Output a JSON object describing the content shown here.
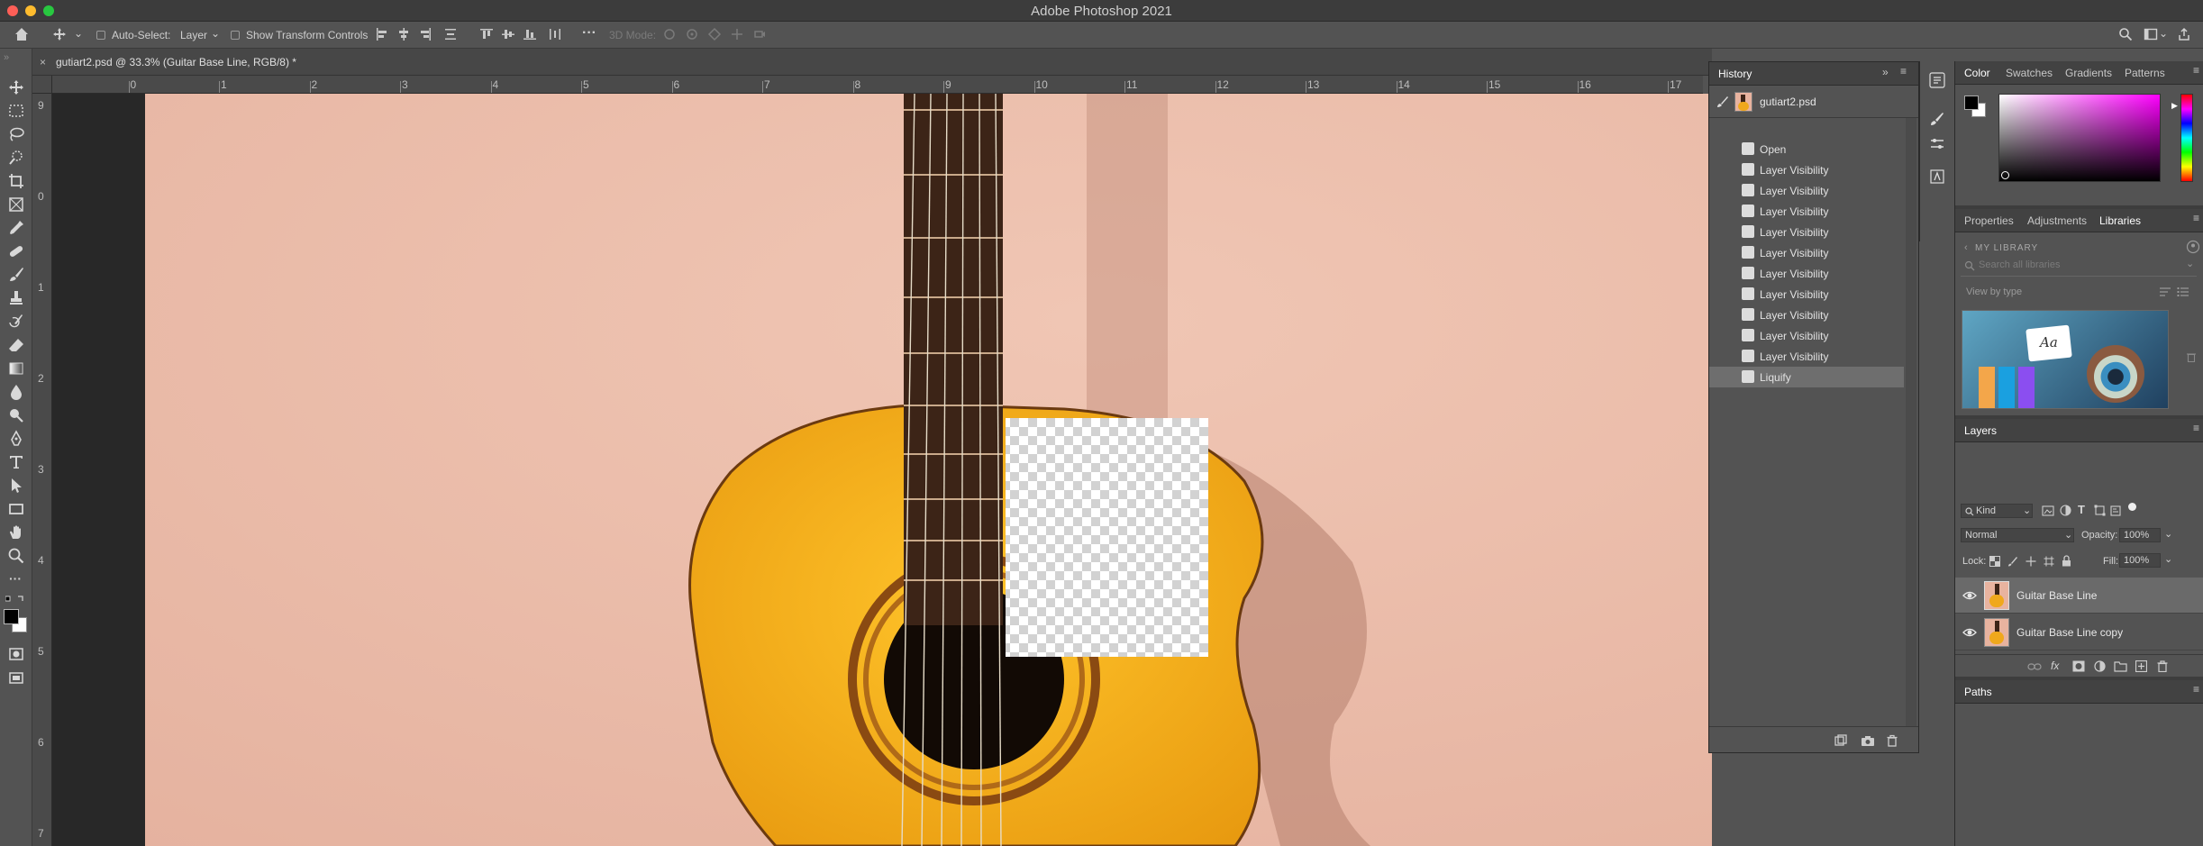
{
  "app_title": "Adobe Photoshop 2021",
  "options": {
    "auto_select_label": "Auto-Select:",
    "auto_select_value": "Layer",
    "show_transform_label": "Show Transform Controls",
    "mode_3d_label": "3D Mode:"
  },
  "document": {
    "tab_title": "gutiart2.psd @ 33.3% (Guitar Base Line, RGB/8) *",
    "ruler_top": [
      "1",
      "0",
      "1",
      "2",
      "3",
      "4",
      "5",
      "6",
      "7",
      "8",
      "9",
      "10",
      "11",
      "12",
      "13",
      "14",
      "15",
      "16",
      "17"
    ],
    "ruler_left": [
      "9",
      "0",
      "1",
      "2",
      "3",
      "4",
      "5",
      "6",
      "7"
    ]
  },
  "history": {
    "tab_label": "History",
    "snapshot_name": "gutiart2.psd",
    "items": [
      "Open",
      "Layer Visibility",
      "Layer Visibility",
      "Layer Visibility",
      "Layer Visibility",
      "Layer Visibility",
      "Layer Visibility",
      "Layer Visibility",
      "Layer Visibility",
      "Layer Visibility",
      "Layer Visibility",
      "Liquify"
    ],
    "active_index": 11
  },
  "color_panel": {
    "tabs": [
      "Color",
      "Swatches",
      "Gradients",
      "Patterns"
    ],
    "active_tab": "Color"
  },
  "libraries_panel": {
    "tabs": [
      "Properties",
      "Adjustments",
      "Libraries"
    ],
    "active_tab": "Libraries",
    "library_name": "MY LIBRARY",
    "search_placeholder": "Search all libraries",
    "view_by": "View by type",
    "thumb_text": "Aa"
  },
  "layers_panel": {
    "tab_label": "Layers",
    "filter_kind": "Kind",
    "blend_mode": "Normal",
    "opacity_label": "Opacity:",
    "opacity_value": "100%",
    "lock_label": "Lock:",
    "fill_label": "Fill:",
    "fill_value": "100%",
    "layers": [
      {
        "name": "Guitar Base Line",
        "selected": true
      },
      {
        "name": "Guitar Base Line copy",
        "selected": false
      }
    ]
  },
  "paths_panel": {
    "tab_label": "Paths"
  },
  "colors": {
    "accent": "#1473e6",
    "background": "#535353",
    "canvas": "#282828",
    "wall": "#e9b9a6",
    "guitar": "#f0a81c"
  }
}
